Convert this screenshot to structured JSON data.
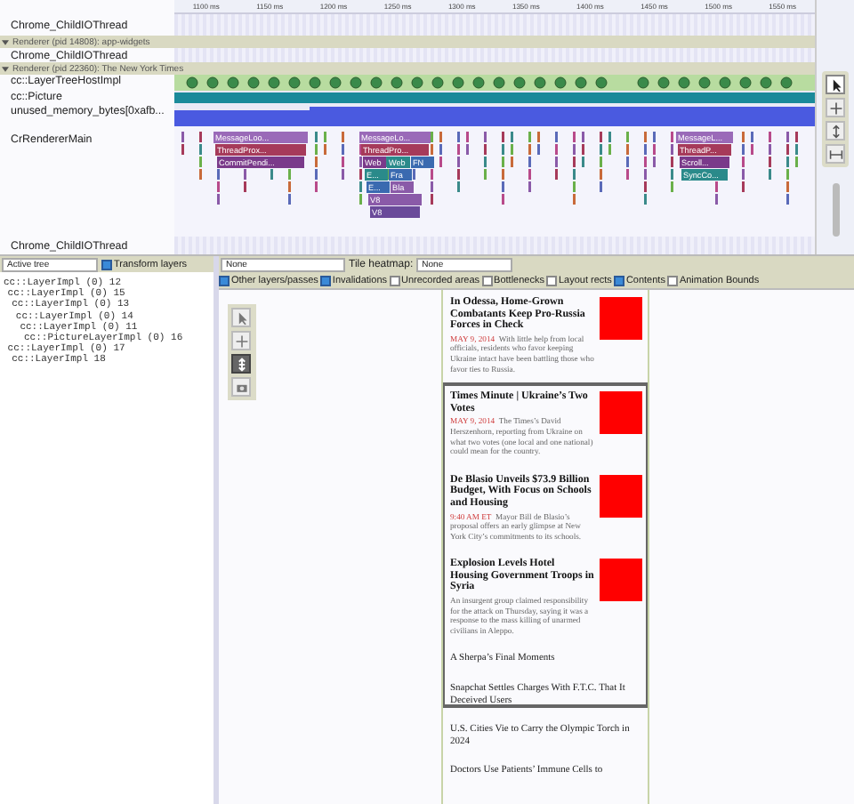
{
  "ruler": {
    "ticks": [
      "1100 ms",
      "1150 ms",
      "1200 ms",
      "1250 ms",
      "1300 ms",
      "1350 ms",
      "1400 ms",
      "1450 ms",
      "1500 ms",
      "1550 ms"
    ]
  },
  "tracks": [
    {
      "kind": "thread",
      "label": "Chrome_ChildIOThread"
    },
    {
      "kind": "process",
      "label": "Renderer (pid 14808): app-widgets",
      "expanded": true
    },
    {
      "kind": "thread",
      "label": "Chrome_ChildIOThread"
    },
    {
      "kind": "process",
      "label": "Renderer (pid 22360): The New York Times",
      "expanded": true
    },
    {
      "kind": "dots",
      "label": "cc::LayerTreeHostImpl"
    },
    {
      "kind": "bar",
      "label": "cc::Picture"
    },
    {
      "kind": "counter",
      "label": "unused_memory_bytes[0xafb..."
    },
    {
      "kind": "flame",
      "label": "CrRendererMain",
      "groups": [
        {
          "levels": [
            [
              "MessageLoo..."
            ],
            [
              "ThreadProx..."
            ],
            [
              "CommitPendi..."
            ]
          ]
        },
        {
          "levels": [
            [
              "MessageLo..."
            ],
            [
              "ThreadPro..."
            ],
            [
              "Web",
              "Web",
              "FN"
            ],
            [
              "E...",
              "Fra"
            ],
            [
              "E...",
              "Bla"
            ],
            [
              "V8"
            ],
            [
              "V8"
            ]
          ]
        },
        {
          "levels": [
            [
              "MessageL..."
            ],
            [
              "ThreadP..."
            ],
            [
              "Scroll..."
            ],
            [
              "SyncCo..."
            ]
          ]
        }
      ]
    },
    {
      "kind": "thread",
      "label": "Chrome_ChildIOThread"
    }
  ],
  "layers_toolbar": {
    "tree_select": "Active tree",
    "transform_layers": {
      "label": "Transform layers",
      "checked": true
    }
  },
  "layer_tree": [
    {
      "label": "cc::LayerImpl (0) 12",
      "children": [
        {
          "label": "cc::LayerImpl (0) 15",
          "children": [
            {
              "label": "cc::LayerImpl (0) 13",
              "children": [
                {
                  "label": "cc::LayerImpl (0) 14",
                  "children": [
                    {
                      "label": "cc::LayerImpl (0) 11",
                      "children": [
                        {
                          "label": "cc::PictureLayerImpl (0) 16"
                        }
                      ]
                    }
                  ]
                }
              ]
            }
          ]
        },
        {
          "label": "cc::LayerImpl (0) 17",
          "children": [
            {
              "label": "cc::LayerImpl 18"
            }
          ]
        }
      ]
    }
  ],
  "view_toolbar": {
    "overlay_select": "None",
    "heatmap_label": "Tile heatmap:",
    "heatmap_select": "None",
    "options": [
      {
        "label": "Other layers/passes",
        "checked": true
      },
      {
        "label": "Invalidations",
        "checked": true
      },
      {
        "label": "Unrecorded areas",
        "checked": false
      },
      {
        "label": "Bottlenecks",
        "checked": false
      },
      {
        "label": "Layout rects",
        "checked": false
      },
      {
        "label": "Contents",
        "checked": true
      },
      {
        "label": "Animation Bounds",
        "checked": false
      }
    ]
  },
  "view_tools": [
    {
      "kind": "select",
      "selected": false
    },
    {
      "kind": "pan",
      "selected": false
    },
    {
      "kind": "rotate",
      "selected": true
    },
    {
      "kind": "camera",
      "selected": false
    }
  ],
  "timeline_tools": [
    {
      "kind": "select",
      "selected": true
    },
    {
      "kind": "pan",
      "selected": false
    },
    {
      "kind": "zoom",
      "selected": false
    },
    {
      "kind": "timing",
      "selected": false
    }
  ],
  "page": [
    {
      "kind": "story",
      "headline": "In Odessa, Home-Grown Combatants Keep Pro-Russia Forces in Check",
      "meta": "MAY 9, 2014",
      "summary": "With little help from local officials, residents who favor keeping Ukraine intact have been battling those who favor ties to Russia."
    },
    {
      "kind": "story",
      "headline": "Times Minute | Ukraine’s Two Votes",
      "meta": "MAY 9, 2014",
      "summary": "The Times’s David Herszenhorn, reporting from Ukraine on what two votes (one local and one national) could mean for the country."
    },
    {
      "kind": "story",
      "headline": "De Blasio Unveils $73.9 Billion Budget, With Focus on Schools and Housing",
      "meta": "9:40 AM ET",
      "summary": "Mayor Bill de Blasio’s proposal offers an early glimpse at New York City’s commitments to its schools."
    },
    {
      "kind": "story",
      "headline": "Explosion Levels Hotel Housing Government Troops in Syria",
      "summary": "An insurgent group claimed responsibility for the attack on Thursday, saying it was a response to the mass killing of unarmed civilians in Aleppo."
    },
    {
      "kind": "link",
      "headline": "A Sherpa’s Final Moments"
    },
    {
      "kind": "link",
      "headline": "Snapchat Settles Charges With F.T.C. That It Deceived Users"
    },
    {
      "kind": "link",
      "headline": "U.S. Cities Vie to Carry the Olympic Torch in 2024"
    },
    {
      "kind": "link",
      "headline": "Doctors Use Patients’ Immune Cells to"
    }
  ]
}
